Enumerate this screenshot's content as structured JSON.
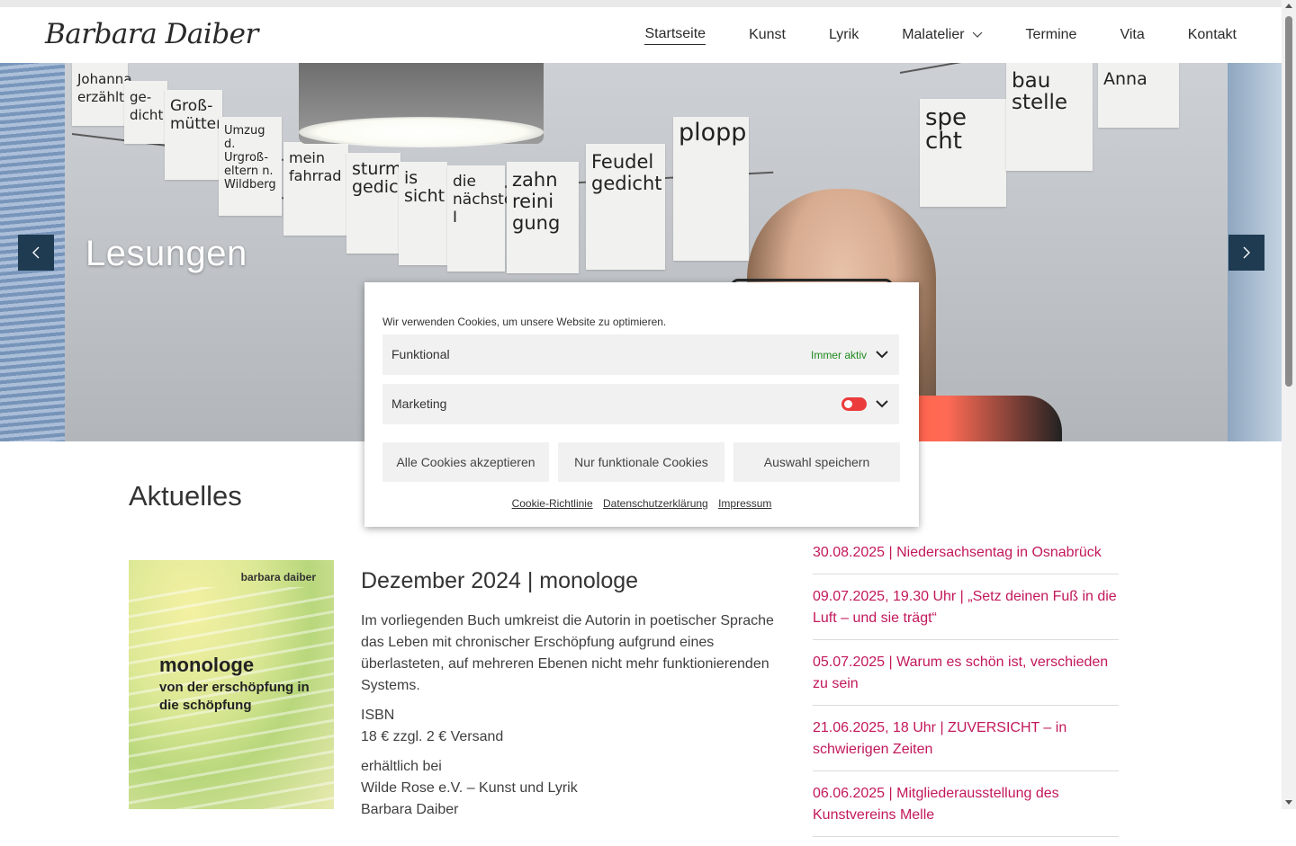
{
  "site": {
    "logo_text": "Barbara Daiber"
  },
  "nav": {
    "items": [
      {
        "label": "Startseite",
        "active": true
      },
      {
        "label": "Kunst"
      },
      {
        "label": "Lyrik"
      },
      {
        "label": "Malatelier",
        "has_dropdown": true
      },
      {
        "label": "Termine"
      },
      {
        "label": "Vita"
      },
      {
        "label": "Kontakt"
      }
    ]
  },
  "hero": {
    "title": "Lesungen",
    "papers": [
      "Johanna erzählt",
      "ge-dicht",
      "Groß-mütter",
      "Umzug d. Urgroß-eltern n. Wildberg",
      "mein fahrrad",
      "sturm gedicht",
      "is sicht",
      "die nächste I",
      "zahn reini gung",
      "Feudel gedicht",
      "plopp",
      "spe cht",
      "bau stelle",
      "Anna"
    ],
    "prev_icon": "chevron-left-icon",
    "next_icon": "chevron-right-icon"
  },
  "main": {
    "heading": "Aktuelles",
    "book": {
      "author": "barbara daiber",
      "title": "monologe",
      "subtitle": "von der erschöpfung in die schöpfung"
    },
    "post": {
      "title": "Dezember 2024 | monologe",
      "paragraph1": "Im vorliegenden Buch umkreist die Autorin in poetischer Sprache das Leben mit chronischer Erschöpfung aufgrund eines überlasteten, auf mehreren Ebenen nicht mehr funktionierenden Systems.",
      "isbn": "ISBN",
      "price": "18 € zzgl. 2 € Versand",
      "available_label": "erhältlich bei",
      "seller1": "Wilde Rose e.V. – Kunst und Lyrik",
      "seller2": "Barbara Daiber"
    },
    "events": [
      "30.08.2025 | Niedersachsentag in Osnabrück",
      "09.07.2025, 19.30 Uhr | „Setz deinen Fuß in die Luft – und sie trägt“",
      "05.07.2025 | Warum es schön ist, verschieden zu sein",
      "21.06.2025, 18 Uhr | ZUVERSICHT – in schwierigen Zeiten",
      "06.06.2025 | Mitgliederausstellung des Kunstvereins Melle"
    ],
    "event_color": "#c2185b"
  },
  "cookie": {
    "intro": "Wir verwenden Cookies, um unsere Website zu optimieren.",
    "categories": [
      {
        "label": "Funktional",
        "status": "Immer aktiv"
      },
      {
        "label": "Marketing",
        "toggle_on": false
      }
    ],
    "buttons": {
      "accept_all": "Alle Cookies akzeptieren",
      "functional_only": "Nur funktionale Cookies",
      "save": "Auswahl speichern"
    },
    "links": {
      "policy": "Cookie-Richtlinie",
      "privacy": "Datenschutzerklärung",
      "imprint": "Impressum"
    },
    "status_color": "#1e8a1e",
    "toggle_color": "#eb3b3b"
  }
}
